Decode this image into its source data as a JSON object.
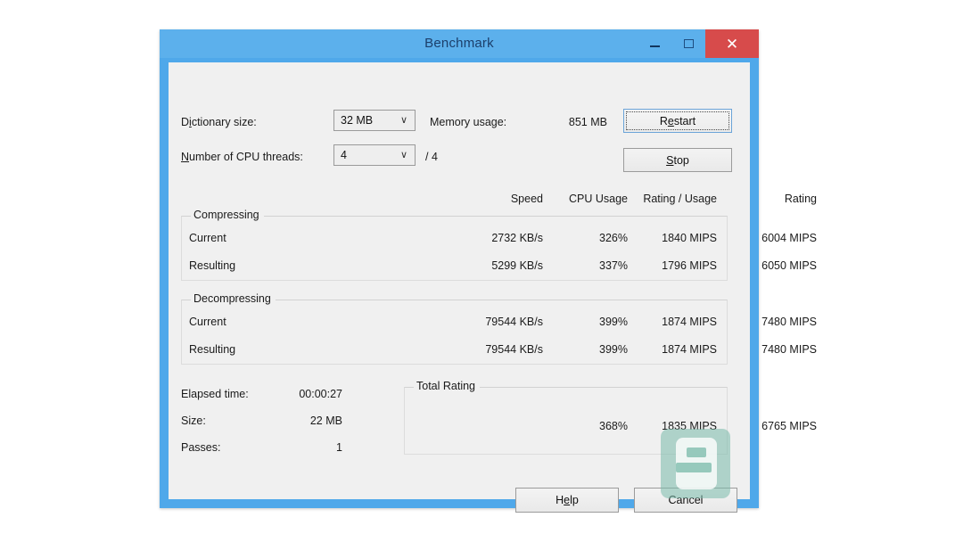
{
  "window": {
    "title": "Benchmark",
    "caption_buttons": [
      {
        "name": "minimize",
        "glyph": "–"
      },
      {
        "name": "maximize",
        "glyph": "□"
      },
      {
        "name": "close",
        "glyph": "✕"
      }
    ]
  },
  "settings": {
    "dictionary_label_pre": "D",
    "dictionary_label_acc": "i",
    "dictionary_label_post": "ctionary size:",
    "dictionary_value": "32 MB",
    "threads_label_acc": "N",
    "threads_label_post": "umber of CPU threads:",
    "threads_value": "4",
    "threads_total": "/ 4",
    "memory_label": "Memory usage:",
    "memory_value": "851 MB",
    "combo_arrow": "∨"
  },
  "actions": {
    "restart_pre": "R",
    "restart_acc": "e",
    "restart_post": "start",
    "stop_pre": "",
    "stop_acc": "S",
    "stop_post": "top",
    "help_pre": "H",
    "help_acc": "e",
    "help_post": "lp",
    "cancel_label": "Cancel"
  },
  "table": {
    "headers": {
      "speed": "Speed",
      "cpu_usage": "CPU Usage",
      "rating_usage": "Rating / Usage",
      "rating": "Rating"
    },
    "compressing": {
      "title": "Compressing",
      "rows": [
        {
          "label": "Current",
          "speed": "2732 KB/s",
          "cpu": "326%",
          "rating_usage": "1840 MIPS",
          "rating": "6004 MIPS"
        },
        {
          "label": "Resulting",
          "speed": "5299 KB/s",
          "cpu": "337%",
          "rating_usage": "1796 MIPS",
          "rating": "6050 MIPS"
        }
      ]
    },
    "decompressing": {
      "title": "Decompressing",
      "rows": [
        {
          "label": "Current",
          "speed": "79544 KB/s",
          "cpu": "399%",
          "rating_usage": "1874 MIPS",
          "rating": "7480 MIPS"
        },
        {
          "label": "Resulting",
          "speed": "79544 KB/s",
          "cpu": "399%",
          "rating_usage": "1874 MIPS",
          "rating": "7480 MIPS"
        }
      ]
    }
  },
  "stats": {
    "elapsed_label": "Elapsed time:",
    "elapsed_value": "00:00:27",
    "size_label": "Size:",
    "size_value": "22 MB",
    "passes_label": "Passes:",
    "passes_value": "1"
  },
  "total_rating": {
    "title": "Total Rating",
    "cpu": "368%",
    "rating_usage": "1835 MIPS",
    "rating": "6765 MIPS"
  },
  "colors": {
    "title_bar": "#5cb0ec",
    "window_frame": "#4fa8ea",
    "close_button": "#d74b4b",
    "client_bg": "#f0f0f0",
    "watermark": "#78baaa"
  }
}
